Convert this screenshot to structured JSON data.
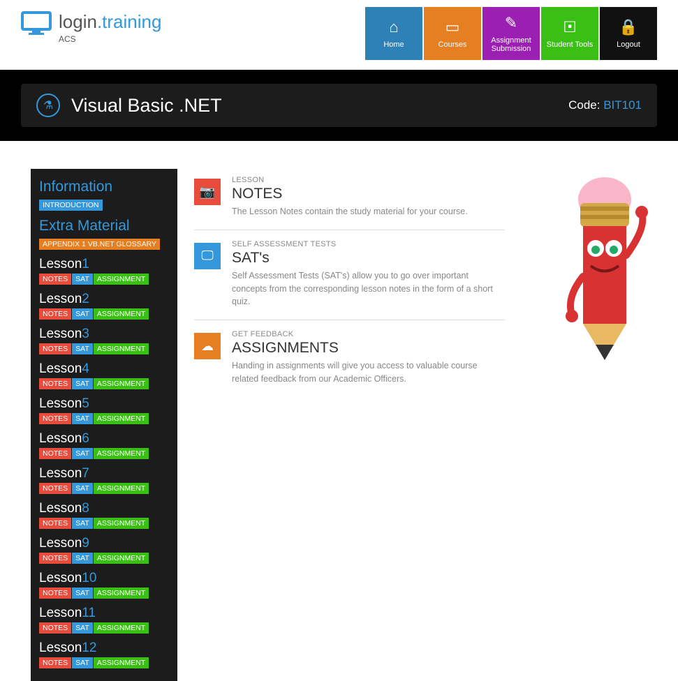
{
  "brand": {
    "login": "login",
    "training": ".training",
    "sub": "ACS"
  },
  "nav": {
    "home": "Home",
    "courses": "Courses",
    "assignment": "Assignment Submission",
    "tools": "Student Tools",
    "logout": "Logout"
  },
  "course": {
    "title": "Visual Basic .NET",
    "code_label": "Code: ",
    "code": "BIT101"
  },
  "sidebar": {
    "info_heading": "Information",
    "intro_badge": "INTRODUCTION",
    "extra_heading": "Extra Material",
    "appendix_badge": "APPENDIX 1 VB.NET GLOSSARY",
    "lesson_prefix": "Lesson",
    "notes": "NOTES",
    "sat": "SAT",
    "assign": "ASSIGNMENT",
    "lessons": [
      "1",
      "2",
      "3",
      "4",
      "5",
      "6",
      "7",
      "8",
      "9",
      "10",
      "11",
      "12"
    ]
  },
  "info": {
    "notes": {
      "label": "LESSON",
      "title": "NOTES",
      "desc": "The Lesson Notes contain the study material for your course."
    },
    "sat": {
      "label": "SELF ASSESSMENT TESTS",
      "title": "SAT's",
      "desc": "Self Assessment Tests (SAT's) allow you to go over important concepts from the corresponding lesson notes in the form of a short quiz."
    },
    "assign": {
      "label": "GET FEEDBACK",
      "title": "ASSIGNMENTS",
      "desc": "Handing in assignments will give you access to valuable course related feedback from our Academic Officers."
    }
  }
}
